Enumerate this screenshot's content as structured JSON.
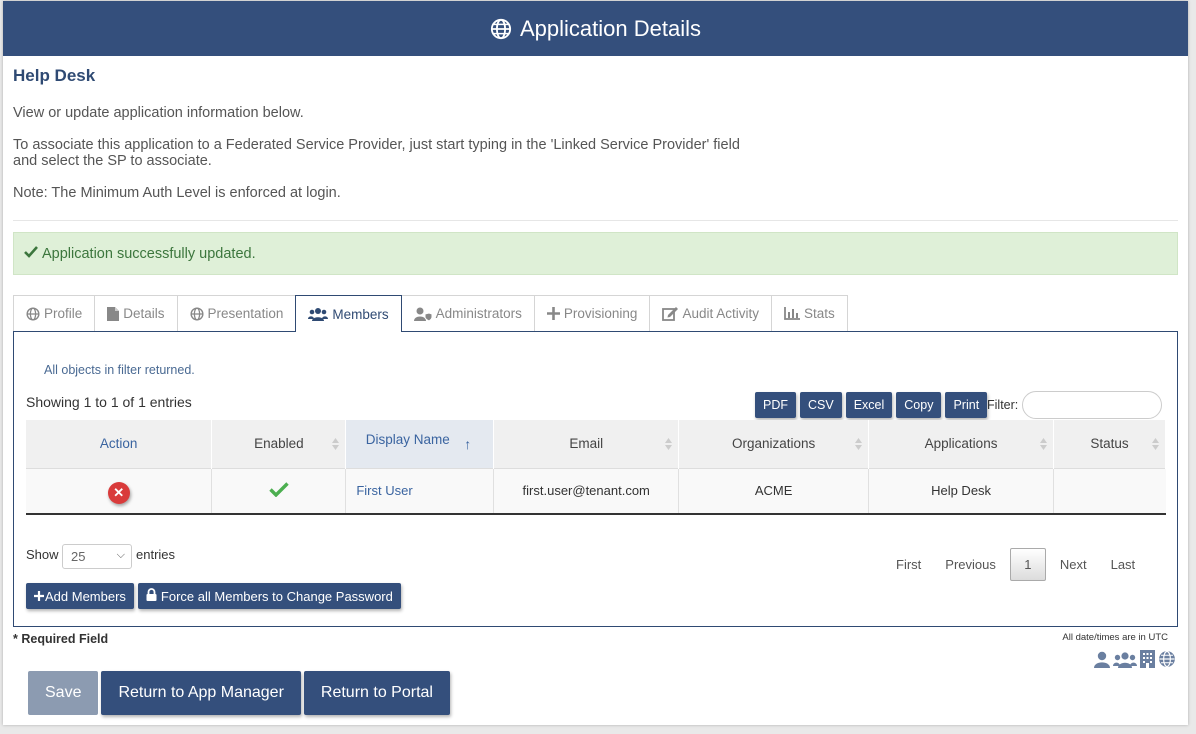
{
  "header": {
    "title": "Application Details",
    "icon": "globe-icon"
  },
  "app_name": "Help Desk",
  "intro": {
    "line1": "View or update application information below.",
    "line2a": "To associate this application to a Federated Service Provider, just start typing in the 'Linked Service Provider' field",
    "line2b": "and select the SP to associate.",
    "line3": "Note: The Minimum Auth Level is enforced at login."
  },
  "alert": {
    "text": "Application successfully updated.",
    "icon": "check-icon",
    "color": "#3c763d"
  },
  "tabs": [
    {
      "label": "Profile",
      "icon": "globe-icon"
    },
    {
      "label": "Details",
      "icon": "file-icon"
    },
    {
      "label": "Presentation",
      "icon": "globe-icon"
    },
    {
      "label": "Members",
      "icon": "users-icon",
      "active": true
    },
    {
      "label": "Administrators",
      "icon": "user-shield-icon"
    },
    {
      "label": "Provisioning",
      "icon": "plus-icon"
    },
    {
      "label": "Audit Activity",
      "icon": "edit-icon"
    },
    {
      "label": "Stats",
      "icon": "chart-icon"
    }
  ],
  "members": {
    "filter_note": "All objects in filter returned.",
    "showing": "Showing 1 to 1 of 1 entries",
    "export_buttons": [
      "PDF",
      "CSV",
      "Excel",
      "Copy",
      "Print"
    ],
    "filter_label": "Filter:",
    "columns": [
      "Action",
      "Enabled",
      "Display Name",
      "Email",
      "Organizations",
      "Applications",
      "Status"
    ],
    "rows": [
      {
        "enabled": "check-icon",
        "display_name": "First User",
        "email": "first.user@tenant.com",
        "organizations": "ACME",
        "applications": "Help Desk",
        "status": ""
      }
    ],
    "show_label": "Show",
    "page_length": "25",
    "entries_label": "entries",
    "pager": {
      "first": "First",
      "previous": "Previous",
      "current": "1",
      "next": "Next",
      "last": "Last"
    },
    "add_members": "Add Members",
    "force_password": "Force all Members to Change Password"
  },
  "required_note": "* Required Field",
  "utc_note": "All date/times are in UTC",
  "footer": {
    "save": "Save",
    "return_app_manager": "Return to App Manager",
    "return_portal": "Return to Portal"
  },
  "colors": {
    "primary": "#344f7c",
    "success_bg": "#dff0d8",
    "danger": "#d93b3b"
  }
}
